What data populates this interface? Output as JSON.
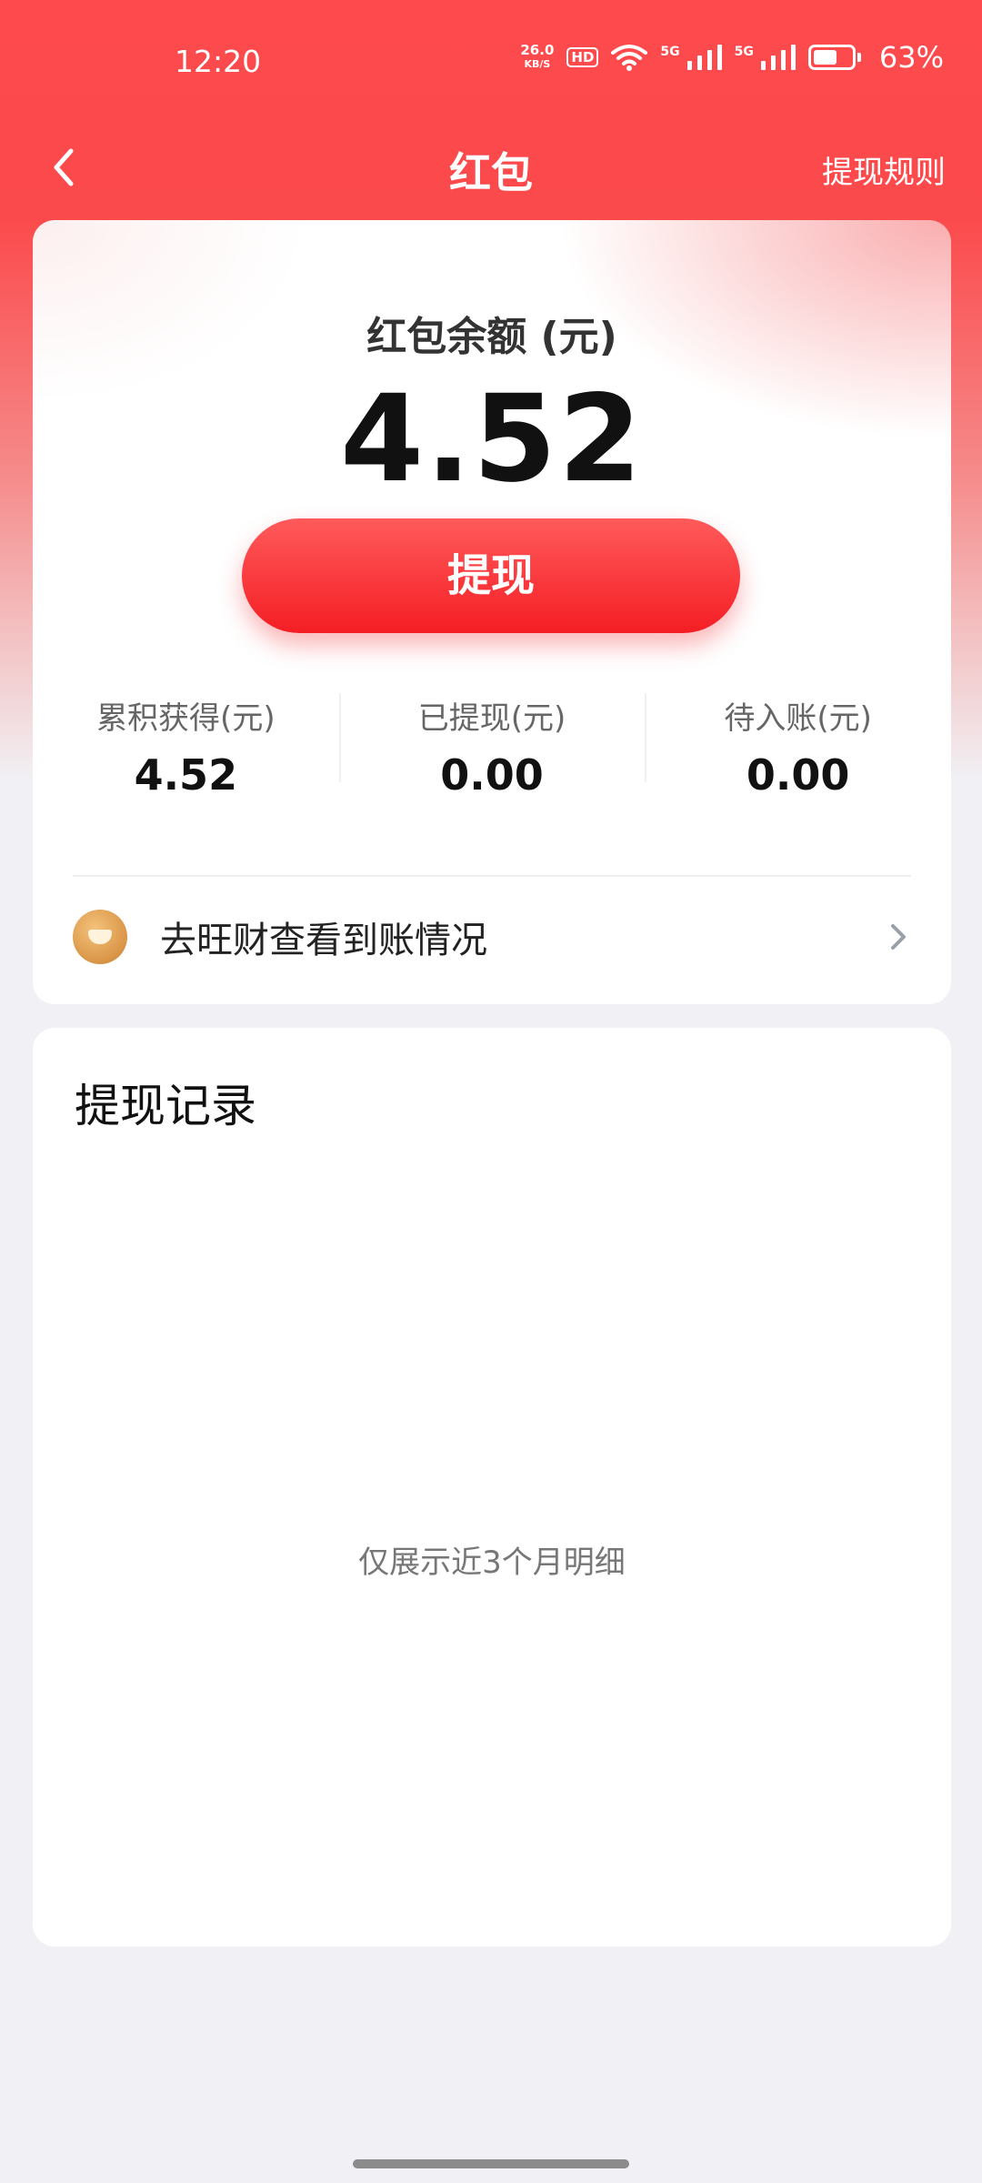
{
  "status_bar": {
    "time": "12:20",
    "net_speed_value": "26.0",
    "net_speed_unit": "KB/S",
    "hd_label": "HD",
    "sim1_label": "5G",
    "sim2_label": "5G",
    "battery_level": 0.63,
    "battery_percent": "63%"
  },
  "nav": {
    "title": "红包",
    "rules_label": "提现规则",
    "back_icon": "chevron-left-icon"
  },
  "balance": {
    "label": "红包余额 (元)",
    "value": "4.52",
    "withdraw_label": "提现",
    "stats": [
      {
        "label": "累积获得(元)",
        "value": "4.52"
      },
      {
        "label": "已提现(元)",
        "value": "0.00"
      },
      {
        "label": "待入账(元)",
        "value": "0.00"
      }
    ],
    "wangcai_link": "去旺财查看到账情况",
    "wangcai_icon": "gold-ingot-icon"
  },
  "records": {
    "title": "提现记录",
    "empty_note": "仅展示近3个月明细"
  },
  "colors": {
    "brand_red": "#fe4a4d",
    "button_red": "#f41e24"
  }
}
